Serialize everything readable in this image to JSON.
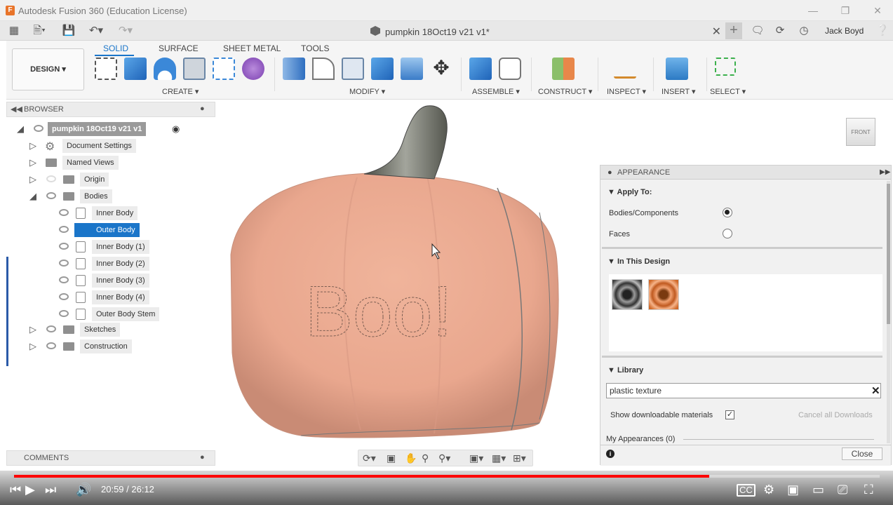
{
  "window": {
    "title": "Autodesk Fusion 360 (Education License)"
  },
  "header": {
    "doc_title": "pumpkin 18Oct19 v21 v1*",
    "user": "Jack Boyd"
  },
  "ribbon": {
    "tabs": [
      "SOLID",
      "SURFACE",
      "SHEET METAL",
      "TOOLS"
    ],
    "workspace": "DESIGN ▾",
    "groups": [
      "CREATE ▾",
      "MODIFY ▾",
      "ASSEMBLE ▾",
      "CONSTRUCT ▾",
      "INSPECT ▾",
      "INSERT ▾",
      "SELECT ▾"
    ]
  },
  "browser": {
    "title": "BROWSER",
    "root": "pumpkin 18Oct19 v21 v1",
    "items": [
      "Document Settings",
      "Named Views",
      "Origin",
      "Bodies",
      "Inner Body",
      "Outer Body",
      "Inner Body (1)",
      "Inner Body (2)",
      "Inner Body (3)",
      "Inner Body (4)",
      "Outer Body Stem",
      "Sketches",
      "Construction"
    ]
  },
  "comments": {
    "title": "COMMENTS"
  },
  "viewcube": {
    "face": "FRONT"
  },
  "model": {
    "engraved_text": "Boo!"
  },
  "appearance": {
    "title": "APPEARANCE",
    "apply_to": "Apply To:",
    "bodies_components": "Bodies/Components",
    "faces": "Faces",
    "in_this_design": "In This Design",
    "library": "Library",
    "search_value": "plastic texture",
    "show_downloadable": "Show downloadable materials",
    "cancel_downloads": "Cancel all Downloads",
    "my_appearances": "My Appearances (0)",
    "close": "Close"
  },
  "video": {
    "time": "20:59 / 26:12",
    "progress": 0.803
  },
  "colors": {
    "accent": "#1a75c9",
    "pumpkin": "#e9a78e",
    "stem": "#6d6f66",
    "progress": "#ff0000"
  }
}
